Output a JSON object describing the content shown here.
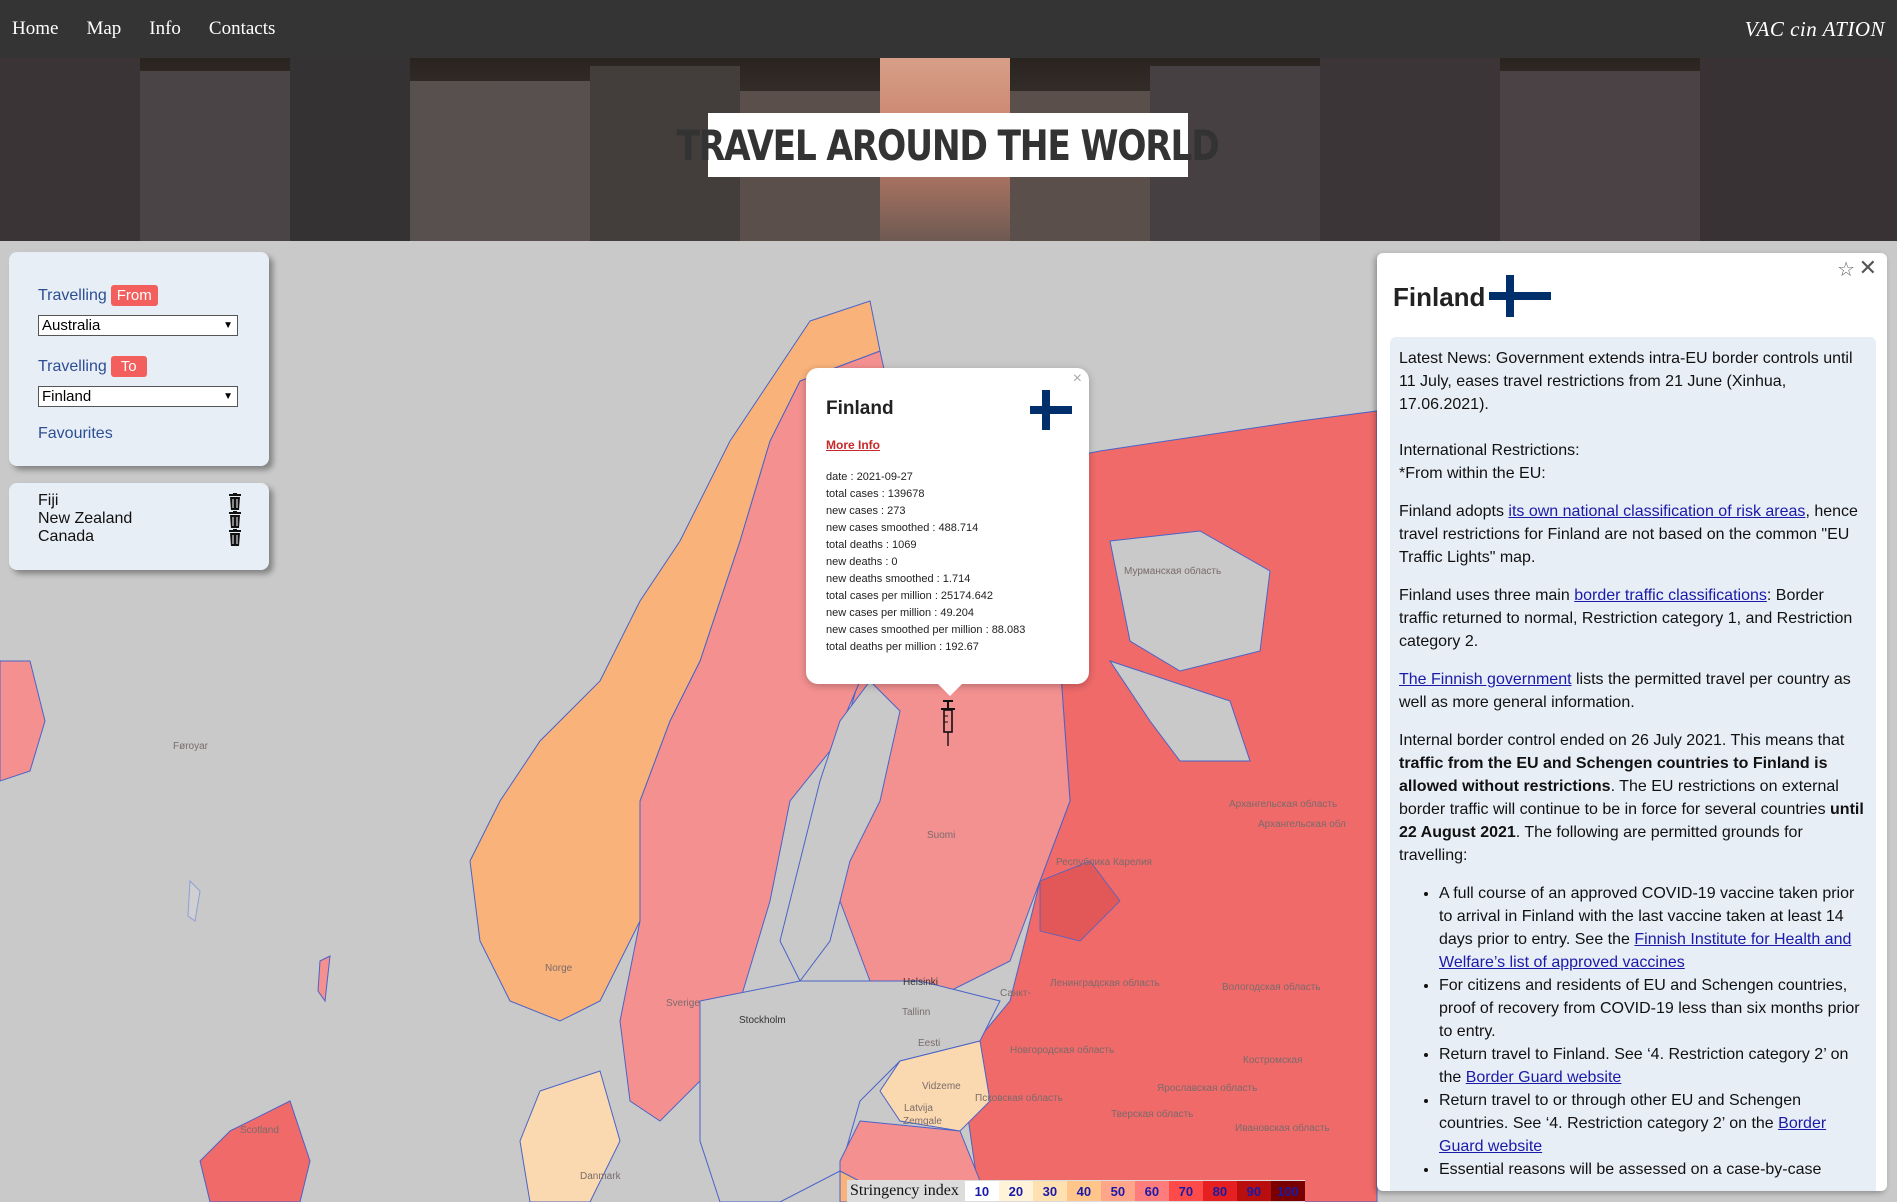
{
  "nav": {
    "links": [
      "Home",
      "Map",
      "Info",
      "Contacts"
    ],
    "brand": "VAC cin ATION"
  },
  "hero": {
    "title": "TRAVEL AROUND THE WORLD"
  },
  "travel": {
    "from_label": "Travelling",
    "from_badge": "From",
    "from_value": "Australia",
    "to_label": "Travelling",
    "to_badge": "To",
    "to_value": "Finland",
    "favourites_link": "Favourites"
  },
  "favourites": {
    "items": [
      "Fiji",
      "New Zealand",
      "Canada"
    ]
  },
  "popup": {
    "close": "×",
    "title": "Finland",
    "more_info": "More Info",
    "stats": [
      "date : 2021-09-27",
      "total cases : 139678",
      "new cases : 273",
      "new cases smoothed : 488.714",
      "total deaths : 1069",
      "new deaths : 0",
      "new deaths smoothed : 1.714",
      "total cases per million : 25174.642",
      "new cases per million : 49.204",
      "new cases smoothed per million : 88.083",
      "total deaths per million : 192.67"
    ]
  },
  "map_labels": {
    "faroe": "Føroyar",
    "norge": "Norge",
    "sverige": "Sverige",
    "suomi": "Suomi",
    "stockholm": "Stockholm",
    "helsinki": "Helsinki",
    "tallinn": "Tallinn",
    "eesti": "Eesti",
    "latvija": "Latvija",
    "scotland": "Scotland",
    "karelia": "Республика Карелия",
    "leningrad": "Ленинградская область",
    "vologda": "Вологодская область",
    "arkhangelsk1": "Архангельская область",
    "arkhangelsk2": "Архангельская обл",
    "murmansk": "Мурманская область",
    "novgorod": "Новгородская область",
    "pskov": "Псковская область",
    "yaroslavl": "Ярославская область",
    "tver": "Тверская область",
    "kostroma": "Костромская",
    "ivanovo": "Ивановская область",
    "vidzeme": "Vidzeme",
    "zemgale": "Zemgale",
    "danmark": "Danmark",
    "spb": "Санкт-"
  },
  "info": {
    "title": "Finland",
    "star": "☆",
    "close": "✕",
    "latest_news": "Latest News: Government extends intra-EU border controls until 11 July, eases travel restrictions from 21 June (Xinhua, 17.06.2021).",
    "intl_heading": "International Restrictions:",
    "eu_heading": "*From within the EU:",
    "p1_pre": "Finland adopts ",
    "p1_link": "its own national classification of risk areas",
    "p1_post": ", hence travel restrictions for Finland are not based on the common \"EU Traffic Lights\" map.",
    "p2_pre": "Finland uses three main ",
    "p2_link": "border traffic classifications",
    "p2_post": ": Border traffic returned to normal, Restriction category 1, and Restriction category 2.",
    "p3_link": "The Finnish government",
    "p3_post": " lists the permitted travel per country as well as more general information.",
    "p4_a": "Internal border control ended on 26 July 2021. This means that ",
    "p4_b": "traffic from the EU and Schengen countries to Finland is allowed without restrictions",
    "p4_c": ". The EU restrictions on external border traffic will continue to be in force for several countries ",
    "p4_d": "until 22 August 2021",
    "p4_e": ". The following are permitted grounds for travelling:",
    "li1_pre": "A full course of an approved COVID-19 vaccine taken prior to arrival in Finland with the last vaccine taken at least 14 days prior to entry. See the ",
    "li1_link": "Finnish Institute for Health and Welfare’s list of approved vaccines",
    "li2": "For citizens and residents of EU and Schengen countries, proof of recovery from COVID-19 less than six months prior to entry.",
    "li3_pre": "Return travel to Finland. See ‘4. Restriction category 2’ on the ",
    "li3_link": "Border Guard website",
    "li4_pre": "Return travel to or through other EU and Schengen countries. See ‘4. Restriction category 2’ on the ",
    "li4_link": "Border Guard website",
    "li5": "Essential reasons will be assessed on a case-by-case"
  },
  "legend": {
    "title": "Stringency index",
    "values": [
      "10",
      "20",
      "30",
      "40",
      "50",
      "60",
      "70",
      "80",
      "90",
      "100"
    ],
    "colors": [
      "#ffffff",
      "#fff3d9",
      "#ffe0b0",
      "#ffc58a",
      "#ffa58a",
      "#ff7c7c",
      "#ff4a4a",
      "#e62020",
      "#b80e0e",
      "#7a0000"
    ]
  },
  "colors": {
    "navbar": "#343434",
    "accent_badge": "#f25f5c",
    "panel_bg": "#e8eef6",
    "link_blue": "#2c4e92",
    "flag_blue": "#002f6c"
  }
}
